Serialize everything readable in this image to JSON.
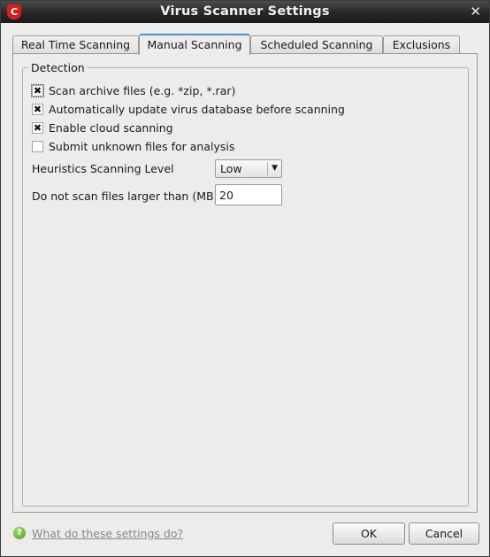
{
  "window": {
    "title": "Virus Scanner Settings",
    "app_icon_letter": "C",
    "close_glyph": "✕"
  },
  "tabs": [
    {
      "label": "Real Time Scanning",
      "active": false
    },
    {
      "label": "Manual Scanning",
      "active": true
    },
    {
      "label": "Scheduled Scanning",
      "active": false
    },
    {
      "label": "Exclusions",
      "active": false
    }
  ],
  "detection": {
    "title": "Detection",
    "options": [
      {
        "label": "Scan archive files (e.g. *zip, *.rar)",
        "checked": true
      },
      {
        "label": "Automatically update virus database before scanning",
        "checked": true
      },
      {
        "label": "Enable cloud scanning",
        "checked": true
      },
      {
        "label": "Submit unknown files for analysis",
        "checked": false
      }
    ],
    "heuristics_label": "Heuristics Scanning Level",
    "heuristics_value": "Low",
    "max_size_label": "Do not scan files larger than (MB)",
    "max_size_value": "20"
  },
  "footer": {
    "help_text": "What do these settings do?",
    "ok_label": "OK",
    "cancel_label": "Cancel"
  },
  "glyphs": {
    "check_mark": "✖",
    "dropdown_arrow": "▼",
    "help_icon": "?"
  },
  "colors": {
    "titlebar": "#262626",
    "app_icon": "#d42020",
    "active_tab_accent": "#4a90d9",
    "help_icon": "#4f9a2a"
  },
  "icons": {
    "app": "comodo-shield-icon",
    "help": "help-icon",
    "close": "close-icon",
    "dropdown": "chevron-down-icon"
  }
}
